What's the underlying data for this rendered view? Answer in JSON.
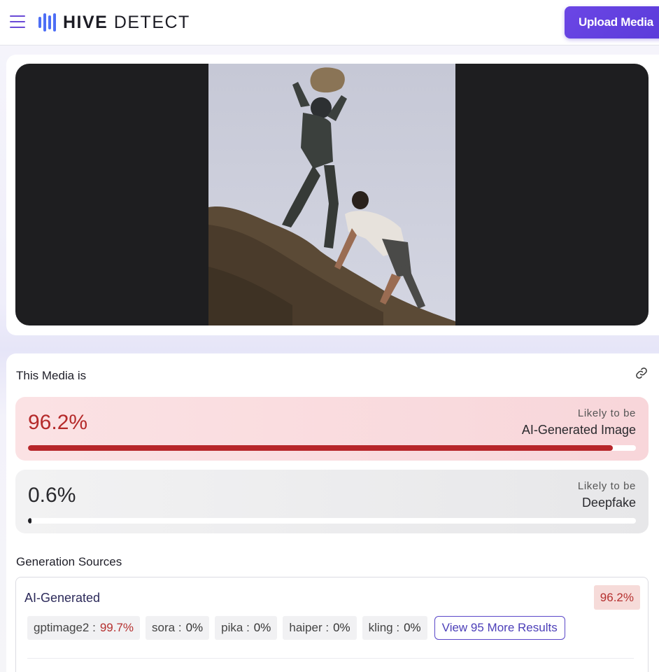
{
  "header": {
    "brand_bold": "HIVE",
    "brand_light": "DETECT",
    "upload_label": "Upload Media"
  },
  "media": {
    "description": "uploaded image preview"
  },
  "result": {
    "title": "This Media is",
    "scores": [
      {
        "value": "96.2%",
        "fraction": 0.962,
        "likely_prefix": "Likely to be",
        "label": "AI-Generated Image",
        "color": "#b7262a"
      },
      {
        "value": "0.6%",
        "fraction": 0.006,
        "likely_prefix": "Likely to be",
        "label": "Deepfake",
        "color": "#1f1f24"
      }
    ],
    "sources_heading": "Generation Sources",
    "sources": {
      "title": "AI-Generated",
      "badge": "96.2%",
      "chips": [
        {
          "name": "gptimage2 :",
          "value": "99.7%"
        },
        {
          "name": "sora :",
          "value": "0%"
        },
        {
          "name": "pika :",
          "value": "0%"
        },
        {
          "name": "haiper :",
          "value": "0%"
        },
        {
          "name": "kling :",
          "value": "0%"
        }
      ],
      "more_label": "View 95 More Results"
    }
  }
}
